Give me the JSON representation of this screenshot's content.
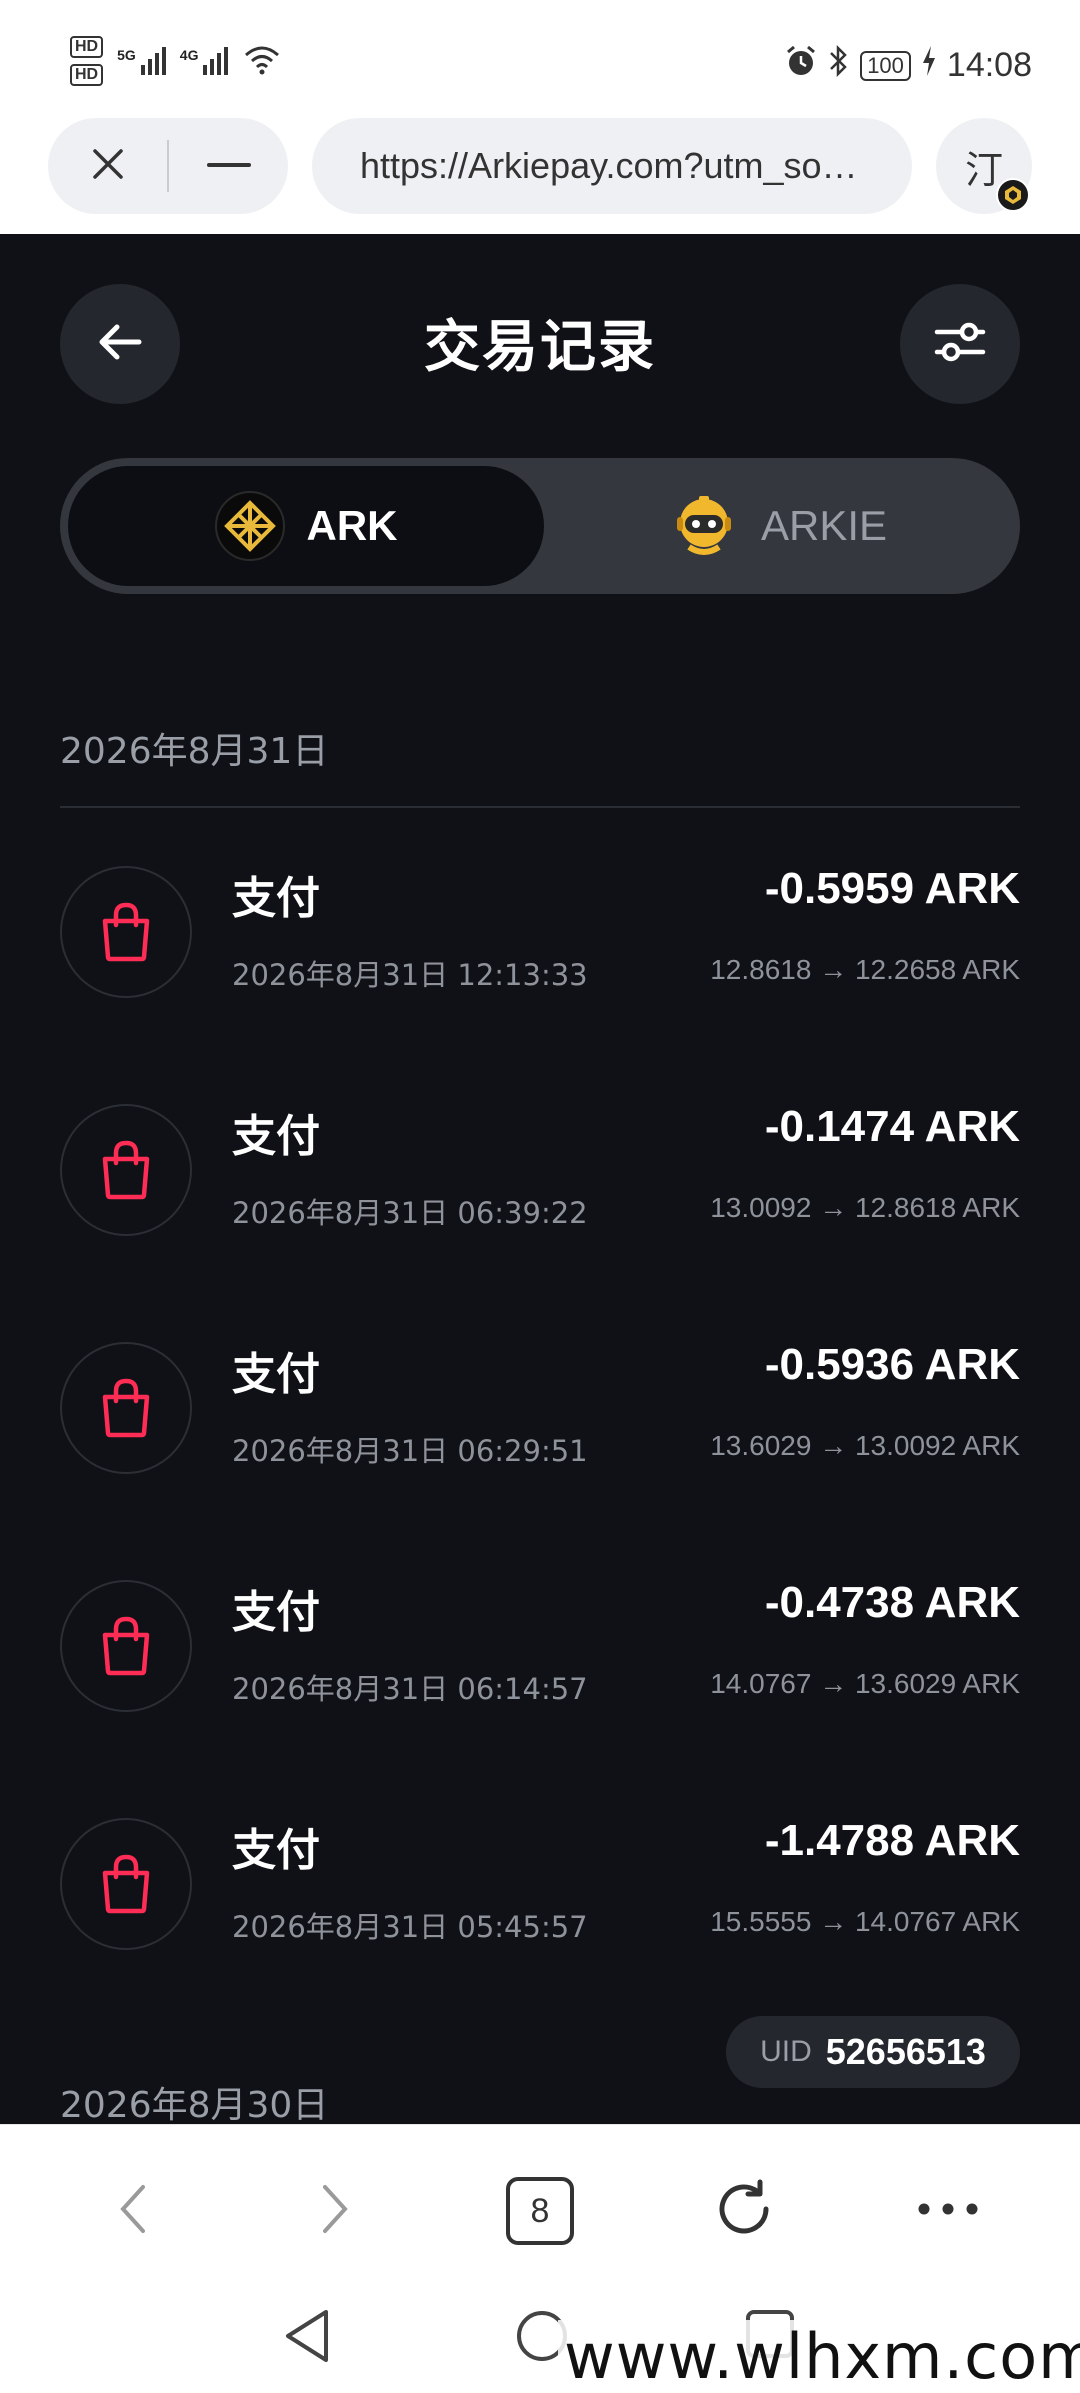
{
  "status_bar": {
    "hd1": "HD",
    "hd2": "HD",
    "net1": "5G",
    "net2": "4G",
    "battery": "100",
    "time": "14:08"
  },
  "browser": {
    "url": "https://Arkiepay.com?utm_source=rk_share",
    "profile_char": "汀"
  },
  "header": {
    "title": "交易记录"
  },
  "token_tabs": [
    {
      "label": "ARK",
      "selected": true
    },
    {
      "label": "ARKIE",
      "selected": false
    }
  ],
  "groups": [
    {
      "date": "2026年8月31日",
      "transactions": [
        {
          "title": "支付",
          "time": "2026年8月31日 12:13:33",
          "amount": "-0.5959 ARK",
          "balance": "12.8618 → 12.2658 ARK"
        },
        {
          "title": "支付",
          "time": "2026年8月31日 06:39:22",
          "amount": "-0.1474 ARK",
          "balance": "13.0092 → 12.8618 ARK"
        },
        {
          "title": "支付",
          "time": "2026年8月31日 06:29:51",
          "amount": "-0.5936 ARK",
          "balance": "13.6029 → 13.0092 ARK"
        },
        {
          "title": "支付",
          "time": "2026年8月31日 06:14:57",
          "amount": "-0.4738 ARK",
          "balance": "14.0767 → 13.6029 ARK"
        },
        {
          "title": "支付",
          "time": "2026年8月31日 05:45:57",
          "amount": "-1.4788 ARK",
          "balance": "15.5555 → 14.0767 ARK"
        }
      ]
    },
    {
      "date": "2026年8月30日",
      "transactions": []
    }
  ],
  "uid": {
    "label": "UID",
    "value": "52656513"
  },
  "toolbar": {
    "tab_count": "8"
  },
  "watermark": "www.wlhxm.com",
  "colors": {
    "app_background": "#0f1117",
    "accent_pay_icon": "#ff2d55",
    "ark_gold": "#e8b93a"
  }
}
